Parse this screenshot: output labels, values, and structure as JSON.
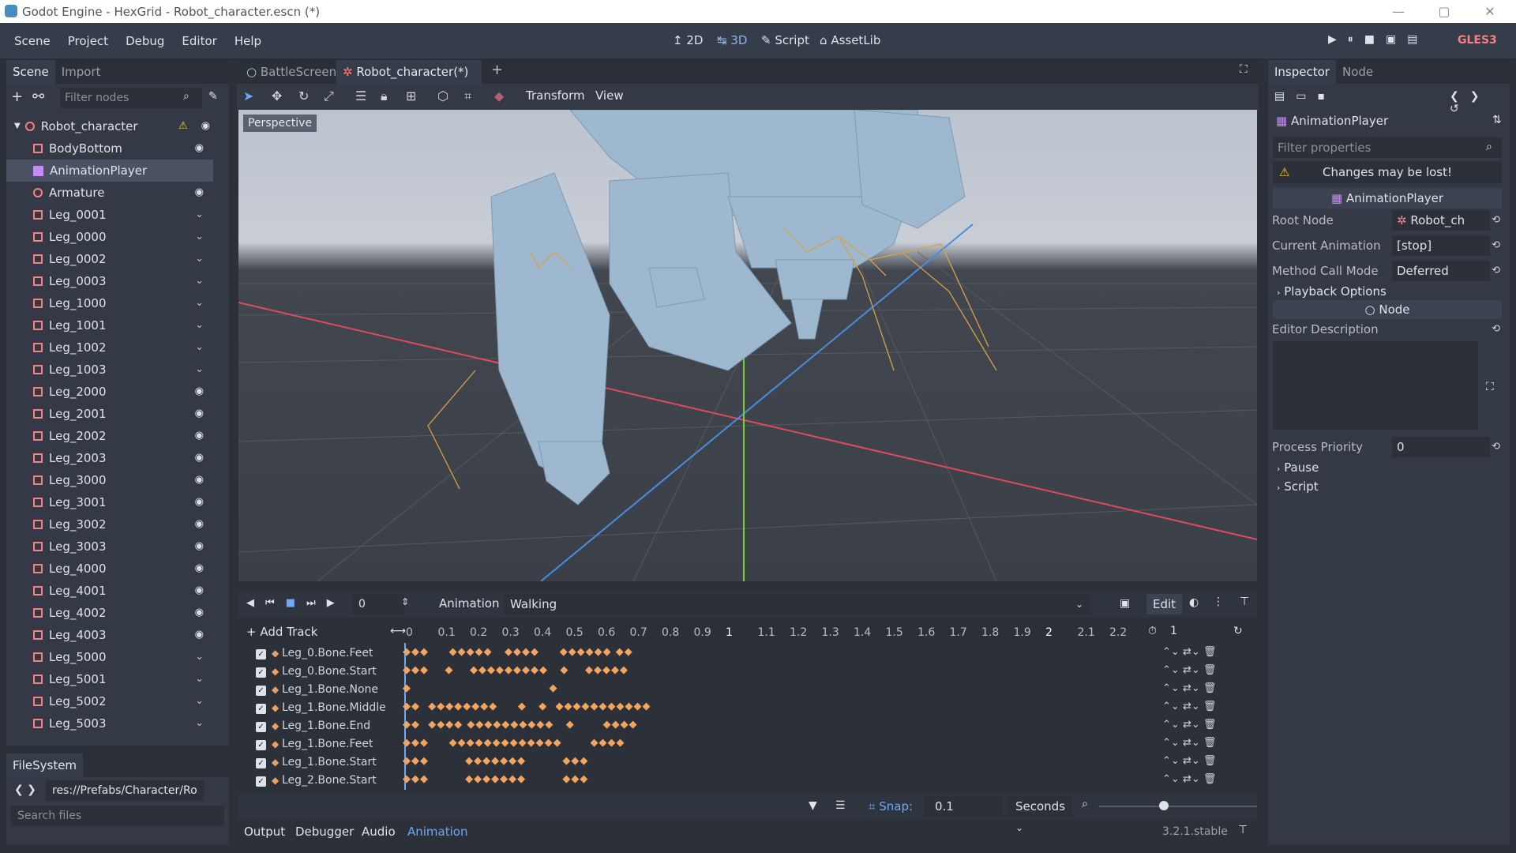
{
  "window": {
    "title": "Godot Engine - HexGrid - Robot_character.escn (*)",
    "min": "—",
    "max": "▢",
    "close": "✕"
  },
  "menu": [
    "Scene",
    "Project",
    "Debug",
    "Editor",
    "Help"
  ],
  "workspaces": [
    "2D",
    "3D",
    "Script",
    "AssetLib"
  ],
  "renderer": "GLES3",
  "scene_dock": {
    "tabs": [
      "Scene",
      "Import"
    ],
    "filter_placeholder": "Filter nodes",
    "root": "Robot_character",
    "nodes": [
      {
        "name": "BodyBottom",
        "icon": "mesh",
        "vis": "eye"
      },
      {
        "name": "AnimationPlayer",
        "icon": "anim",
        "vis": ""
      },
      {
        "name": "Armature",
        "icon": "skeleton",
        "vis": "eye"
      },
      {
        "name": "Leg_0001",
        "icon": "mesh",
        "vis": "chev"
      },
      {
        "name": "Leg_0000",
        "icon": "mesh",
        "vis": "chev"
      },
      {
        "name": "Leg_0002",
        "icon": "mesh",
        "vis": "chev"
      },
      {
        "name": "Leg_0003",
        "icon": "mesh",
        "vis": "chev"
      },
      {
        "name": "Leg_1000",
        "icon": "mesh",
        "vis": "chev"
      },
      {
        "name": "Leg_1001",
        "icon": "mesh",
        "vis": "chev"
      },
      {
        "name": "Leg_1002",
        "icon": "mesh",
        "vis": "chev"
      },
      {
        "name": "Leg_1003",
        "icon": "mesh",
        "vis": "chev"
      },
      {
        "name": "Leg_2000",
        "icon": "mesh",
        "vis": "eye"
      },
      {
        "name": "Leg_2001",
        "icon": "mesh",
        "vis": "eye"
      },
      {
        "name": "Leg_2002",
        "icon": "mesh",
        "vis": "eye"
      },
      {
        "name": "Leg_2003",
        "icon": "mesh",
        "vis": "eye"
      },
      {
        "name": "Leg_3000",
        "icon": "mesh",
        "vis": "eye"
      },
      {
        "name": "Leg_3001",
        "icon": "mesh",
        "vis": "eye"
      },
      {
        "name": "Leg_3002",
        "icon": "mesh",
        "vis": "eye"
      },
      {
        "name": "Leg_3003",
        "icon": "mesh",
        "vis": "eye"
      },
      {
        "name": "Leg_4000",
        "icon": "mesh",
        "vis": "eye"
      },
      {
        "name": "Leg_4001",
        "icon": "mesh",
        "vis": "eye"
      },
      {
        "name": "Leg_4002",
        "icon": "mesh",
        "vis": "eye"
      },
      {
        "name": "Leg_4003",
        "icon": "mesh",
        "vis": "eye"
      },
      {
        "name": "Leg_5000",
        "icon": "mesh",
        "vis": "chev"
      },
      {
        "name": "Leg_5001",
        "icon": "mesh",
        "vis": "chev"
      },
      {
        "name": "Leg_5002",
        "icon": "mesh",
        "vis": "chev"
      },
      {
        "name": "Leg_5003",
        "icon": "mesh",
        "vis": "chev"
      }
    ]
  },
  "filesystem": {
    "tab": "FileSystem",
    "path": "res://Prefabs/Character/Ro",
    "search_placeholder": "Search files"
  },
  "editor_tabs": [
    "BattleScreen",
    "Robot_character(*)"
  ],
  "viewport": {
    "label": "Perspective",
    "menus": [
      "Transform",
      "View"
    ]
  },
  "animation": {
    "frame": "0",
    "label": "Animation",
    "current": "Walking",
    "edit": "Edit",
    "add_track": "Add Track",
    "ruler": [
      "0",
      "0.1",
      "0.2",
      "0.3",
      "0.4",
      "0.5",
      "0.6",
      "0.7",
      "0.8",
      "0.9",
      "1",
      "1.1",
      "1.2",
      "1.3",
      "1.4",
      "1.5",
      "1.6",
      "1.7",
      "1.8",
      "1.9",
      "2",
      "2.1",
      "2.2"
    ],
    "length": "1",
    "tracks": [
      {
        "name": "Leg_0.Bone.Feet",
        "keys": "◆◆◆     ◆◆◆◆◆   ◆◆◆◆     ◆◆◆◆◆◆ ◆◆"
      },
      {
        "name": "Leg_0.Bone.Start",
        "keys": "◆◆◆    ◆    ◆◆◆◆◆◆◆◆◆   ◆    ◆◆◆◆◆"
      },
      {
        "name": "Leg_1.Bone.None",
        "keys": "◆                                  ◆"
      },
      {
        "name": "Leg_1.Bone.Middle",
        "keys": "◆◆  ◆◆◆◆◆◆◆◆     ◆   ◆  ◆◆◆◆◆◆◆◆◆◆◆"
      },
      {
        "name": "Leg_1.Bone.End",
        "keys": "◆◆  ◆◆◆◆ ◆◆◆◆◆◆◆◆◆◆   ◆       ◆◆◆◆"
      },
      {
        "name": "Leg_1.Bone.Feet",
        "keys": "◆◆◆     ◆◆◆◆◆◆◆◆◆◆◆◆◆       ◆◆◆◆"
      },
      {
        "name": "Leg_1.Bone.Start",
        "keys": "◆◆◆         ◆◆◆◆◆◆◆         ◆◆◆"
      },
      {
        "name": "Leg_2.Bone.Start",
        "keys": "◆◆◆         ◆◆◆◆◆◆◆         ◆◆◆"
      }
    ],
    "snap_label": "Snap:",
    "snap": "0.1",
    "unit": "Seconds"
  },
  "bottom_tabs": [
    "Output",
    "Debugger",
    "Audio",
    "Animation"
  ],
  "version": "3.2.1.stable",
  "inspector": {
    "tabs": [
      "Inspector",
      "Node"
    ],
    "node": "AnimationPlayer",
    "filter_placeholder": "Filter properties",
    "warning": "Changes may be lost!",
    "section": "AnimationPlayer",
    "props": [
      {
        "k": "Root Node",
        "v": "Robot_ch"
      },
      {
        "k": "Current Animation",
        "v": "[stop]"
      },
      {
        "k": "Method Call Mode",
        "v": "Deferred"
      }
    ],
    "playback": "Playback Options",
    "node_section": "Node",
    "editor_desc": "Editor Description",
    "priority_label": "Process Priority",
    "priority": "0",
    "pause": "Pause",
    "script": "Script"
  }
}
